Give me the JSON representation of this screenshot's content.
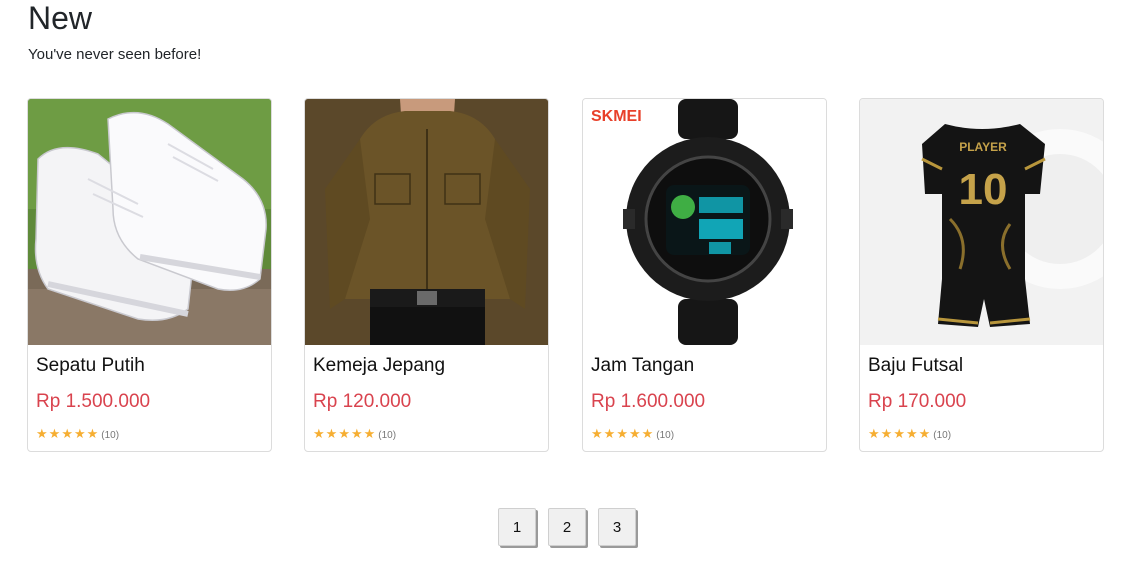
{
  "section": {
    "title": "New",
    "subtitle": "You've never seen before!"
  },
  "products": [
    {
      "name": "Sepatu Putih",
      "price": "Rp 1.500.000",
      "stars": 5,
      "review_count": "(10)",
      "image_icon": "white-sneakers-image"
    },
    {
      "name": "Kemeja Jepang",
      "price": "Rp 120.000",
      "stars": 5,
      "review_count": "(10)",
      "image_icon": "brown-shirt-image"
    },
    {
      "name": "Jam Tangan",
      "price": "Rp 1.600.000",
      "stars": 5,
      "review_count": "(10)",
      "image_icon": "digital-watch-image",
      "image_brand_text": "SKMEI"
    },
    {
      "name": "Baju Futsal",
      "price": "Rp 170.000",
      "stars": 5,
      "review_count": "(10)",
      "image_icon": "futsal-jersey-image",
      "image_jersey_text": "PLAYER",
      "image_jersey_number": "10"
    }
  ],
  "pagination": {
    "pages": [
      "1",
      "2",
      "3"
    ]
  },
  "colors": {
    "price": "#d9434e",
    "star": "#f6ae32",
    "text": "#212529"
  }
}
